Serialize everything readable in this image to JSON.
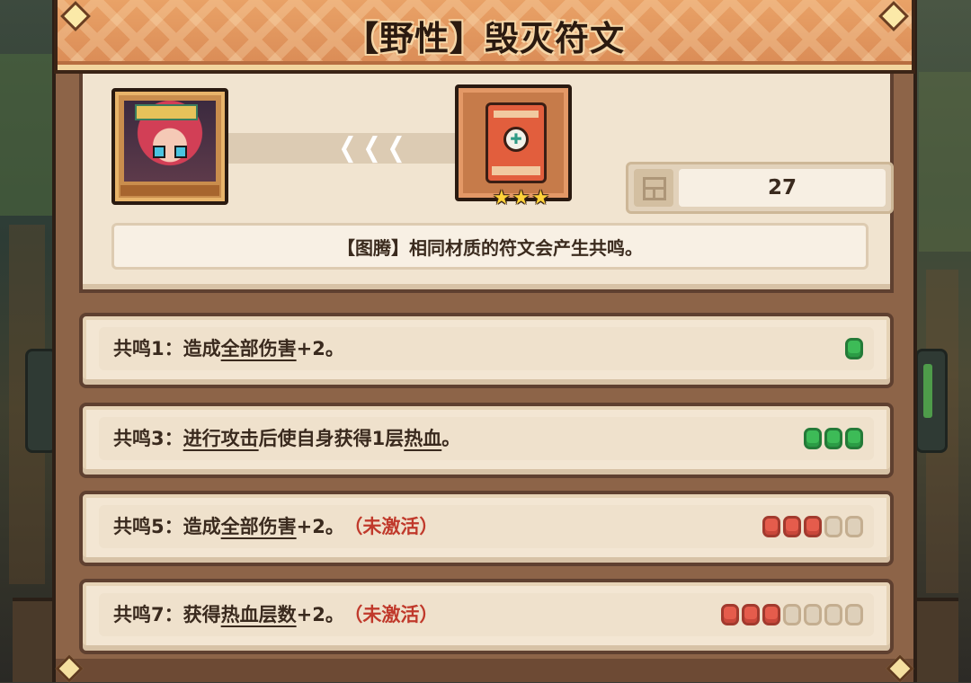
{
  "title": "【野性】毁灭符文",
  "count": "27",
  "description": "【图腾】相同材质的符文会产生共鸣。",
  "arrows": [
    "❮",
    "❮",
    "❮"
  ],
  "stars": [
    "★",
    "★",
    "★"
  ],
  "rune_symbol": "✚",
  "resonances": [
    {
      "label": "共鸣1：",
      "segments": [
        {
          "text": "造成",
          "underline": false
        },
        {
          "text": "全部伤害",
          "underline": true
        },
        {
          "text": "+2。",
          "underline": false
        }
      ],
      "inactive_label": "",
      "filled": 1,
      "total": 1,
      "active": true
    },
    {
      "label": "共鸣3：",
      "segments": [
        {
          "text": "进行攻击",
          "underline": true
        },
        {
          "text": "后使自身获得1层",
          "underline": false
        },
        {
          "text": "热血",
          "underline": true
        },
        {
          "text": "。",
          "underline": false
        }
      ],
      "inactive_label": "",
      "filled": 3,
      "total": 3,
      "active": true
    },
    {
      "label": "共鸣5：",
      "segments": [
        {
          "text": "造成",
          "underline": false
        },
        {
          "text": "全部伤害",
          "underline": true
        },
        {
          "text": "+2。",
          "underline": false
        }
      ],
      "inactive_label": "（未激活）",
      "filled": 3,
      "total": 5,
      "active": false
    },
    {
      "label": "共鸣7：",
      "segments": [
        {
          "text": "获得",
          "underline": false
        },
        {
          "text": "热血层数",
          "underline": true
        },
        {
          "text": "+2。",
          "underline": false
        }
      ],
      "inactive_label": "（未激活）",
      "filled": 3,
      "total": 7,
      "active": false
    }
  ],
  "colors": {
    "active_pip": "#3dbb57",
    "progress_pip": "#e55c4c",
    "empty_pip": "#ded0ba",
    "inactive_text": "#c0392b",
    "title_bar": "#e39a61"
  },
  "icons": {
    "portrait": "hero-portrait",
    "rune": "rune-icon",
    "count": "storage-box-icon"
  }
}
